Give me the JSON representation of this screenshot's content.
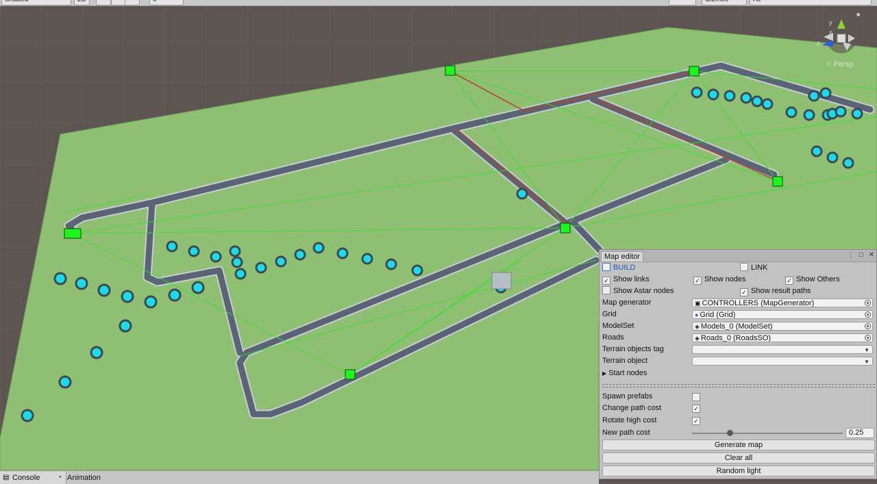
{
  "toolbar": {
    "shading_mode": "Shaded",
    "mode_2d": "2D",
    "gizmos_label": "Gizmos",
    "search_placeholder": "All",
    "count": "0"
  },
  "scene": {
    "camera_label": "< Persp",
    "axis_labels": [
      "y",
      "x",
      "z"
    ],
    "colors": {
      "ground": "#8fbf72",
      "terrain_dark": "#5d5552",
      "road": "#5b6474",
      "road_edge": "#c9cdd3",
      "node": "#1ef51e",
      "link": "#34e42c",
      "result_path": "#b3472a",
      "unit": "#1fd9e6"
    }
  },
  "map_editor": {
    "title": "Map editor",
    "build_label": "BUILD",
    "link_label": "LINK",
    "show_links": "Show links",
    "show_nodes": "Show nodes",
    "show_others": "Show Others",
    "show_astar": "Show Astar nodes",
    "show_result_paths": "Show result paths",
    "fields": {
      "map_generator": {
        "label": "Map generator",
        "value": "CONTROLLERS (MapGenerator)"
      },
      "grid": {
        "label": "Grid",
        "value": "Grid (Grid)"
      },
      "modelset": {
        "label": "ModelSet",
        "value": "Models_0 (ModelSet)"
      },
      "roads": {
        "label": "Roads",
        "value": "Roads_0 (RoadsSO)"
      },
      "terrain_tag": {
        "label": "Terrain objects tag",
        "value": ""
      },
      "terrain_object": {
        "label": "Terrain object",
        "value": ""
      }
    },
    "start_nodes": "Start nodes",
    "spawn_prefabs": "Spawn prefabs",
    "change_path_cost": "Change path cost",
    "rotate_high_cost": "Rotate high cost",
    "new_path_cost_label": "New path cost",
    "new_path_cost_value": "0.25",
    "new_path_cost_fraction": 0.25,
    "buttons": {
      "generate": "Generate map",
      "clear": "Clear all",
      "random_light": "Random light"
    }
  },
  "bottom_tabs": {
    "console": "Console",
    "animation": "Animation"
  }
}
